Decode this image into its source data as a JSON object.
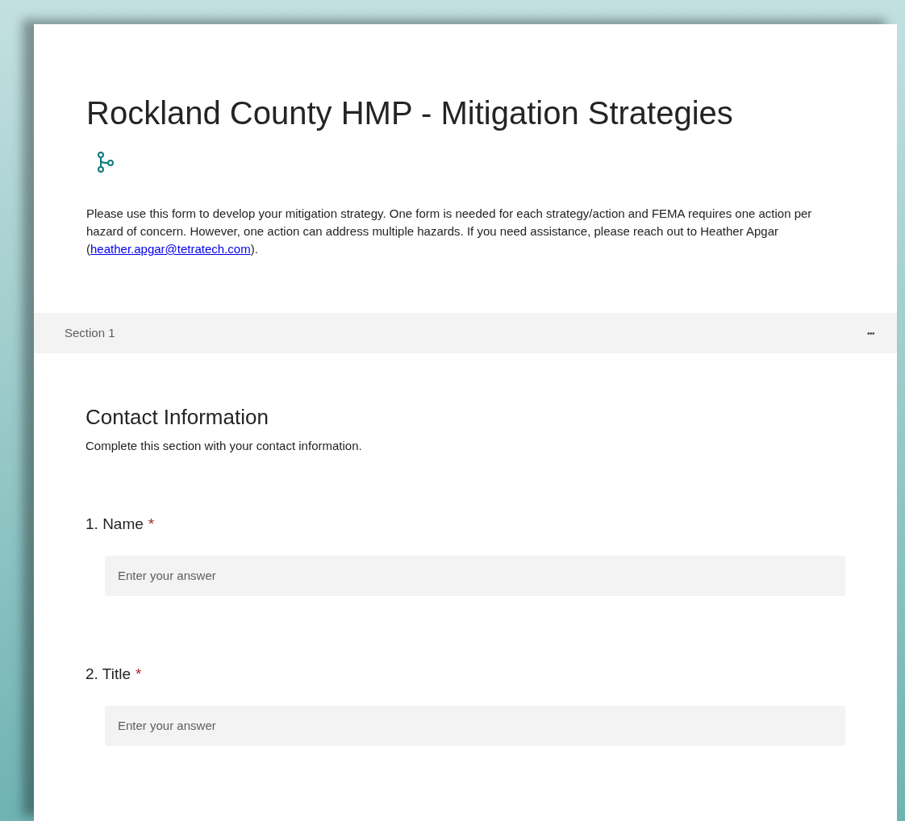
{
  "form": {
    "title": "Rockland County HMP - Mitigation Strategies",
    "description": {
      "before": "Please use this form to develop your mitigation strategy.  One form is needed for each strategy/action and FEMA requires one action per hazard of concern.  However, one action can address multiple hazards.  If you need assistance, please reach out to Heather Apgar (",
      "link": "heather.apgar@tetratech.com",
      "after": ")."
    }
  },
  "section_bar": {
    "label": "Section 1",
    "menu": "•••"
  },
  "section": {
    "title": "Contact Information",
    "subtitle": "Complete this section with your contact information."
  },
  "questions": [
    {
      "number": "1.",
      "label": "Name",
      "required": true,
      "required_mark": "*",
      "placeholder": "Enter your answer"
    },
    {
      "number": "2.",
      "label": "Title",
      "required": true,
      "required_mark": "*",
      "placeholder": "Enter your answer"
    }
  ]
}
